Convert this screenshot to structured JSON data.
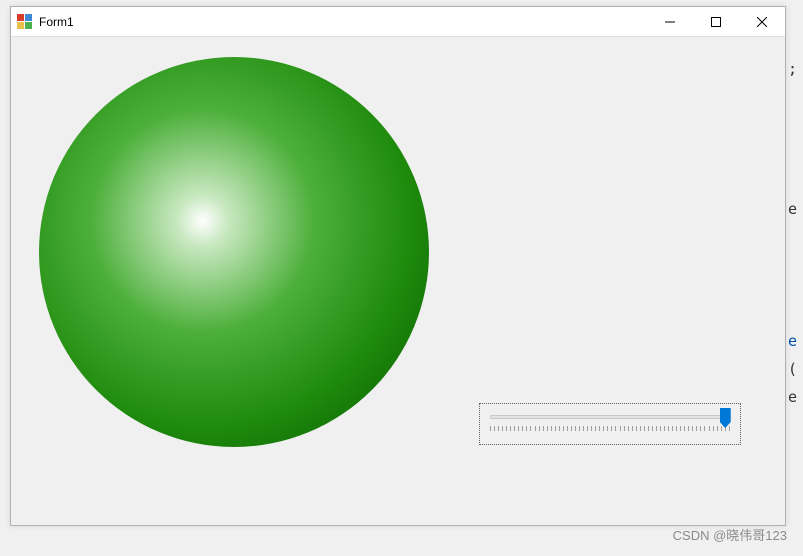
{
  "window": {
    "title": "Form1"
  },
  "sphere": {
    "color_inner": "#ffffff",
    "color_outer": "#0a5a03",
    "radius_px": 195
  },
  "trackbar": {
    "min": 0,
    "max": 100,
    "value": 97,
    "tick_count": 60
  },
  "watermark": {
    "text": "CSDN @晓伟哥123"
  },
  "background_fragments": {
    "semicolon": ";",
    "e1": "e",
    "e2": "e",
    "paren": "(",
    "e3": "e"
  }
}
